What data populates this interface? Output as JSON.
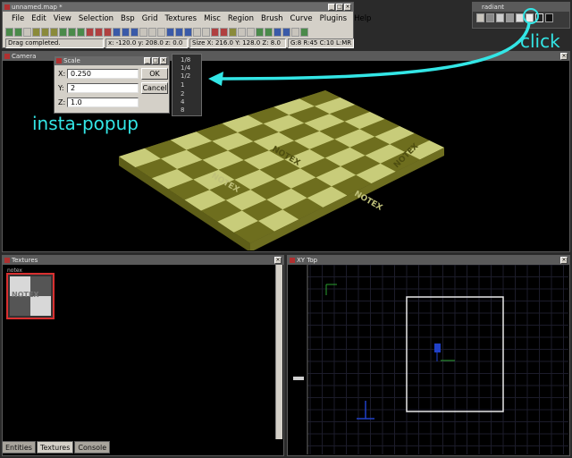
{
  "main_window": {
    "title": "unnamed.map *",
    "menu": [
      "File",
      "Edit",
      "View",
      "Selection",
      "Bsp",
      "Grid",
      "Textures",
      "Misc",
      "Region",
      "Brush",
      "Curve",
      "Plugins",
      "Help"
    ],
    "status": {
      "message": "Drag completed.",
      "coords": "x: -120.0  y: 208.0  z: 0.0",
      "size": "Size X: 216.0  Y: 128.0  Z: 8.0",
      "grid": "G:8 R:45 C:10 L:MR"
    }
  },
  "radiant_window": {
    "title": "radiant"
  },
  "camera": {
    "title": "Camera"
  },
  "scale_dialog": {
    "title": "Scale",
    "x_label": "X:",
    "x_value": "0.250",
    "y_label": "Y:",
    "y_value": "2",
    "z_label": "Z:",
    "z_value": "1.0",
    "ok_label": "OK",
    "cancel_label": "Cancel"
  },
  "quick_values": [
    "1/8",
    "1/4",
    "1/2",
    "1",
    "2",
    "4",
    "8"
  ],
  "annotations": {
    "popup": "insta-popup",
    "click": "click",
    "color": "#33e6e6"
  },
  "textures_pane": {
    "title": "Textures",
    "thumb_label": "notex",
    "logo_text": "NOTEX"
  },
  "xy_pane": {
    "title": "XY Top"
  },
  "floor_logo": "NOTEX",
  "tabs": [
    "Entities",
    "Textures",
    "Console"
  ],
  "active_tab": "Textures",
  "colors": {
    "checker_light": "#c8cc7a",
    "checker_dark": "#6e6e1e",
    "selection": "#d83030",
    "accent": "#33e6e6"
  }
}
